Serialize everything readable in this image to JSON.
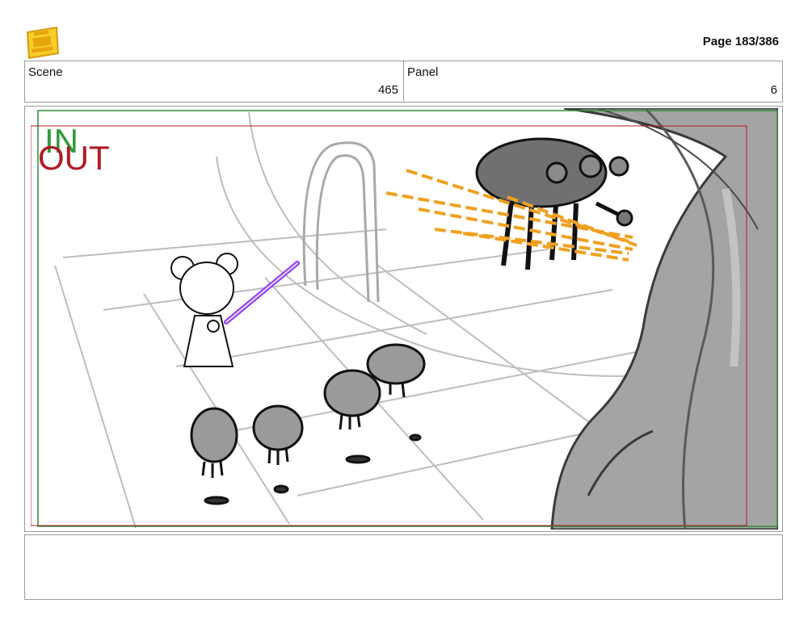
{
  "header": {
    "logo_icon": "young-jedi-adventures-logo",
    "page_label": "Page 183/386"
  },
  "info": {
    "scene_label": "Scene",
    "scene_value": "465",
    "panel_label": "Panel",
    "panel_value": "6"
  },
  "panel": {
    "in_label": "IN",
    "out_label": "OUT",
    "colors": {
      "in_frame": "#2e8b3a",
      "out_frame": "#b01b24",
      "lightsaber": "#8a3cf0",
      "blaster_fire": "#f0a020",
      "sketch_gray": "#b5b5b5",
      "tree_fill": "#9c9c9c"
    }
  },
  "notes": {
    "text": ""
  }
}
